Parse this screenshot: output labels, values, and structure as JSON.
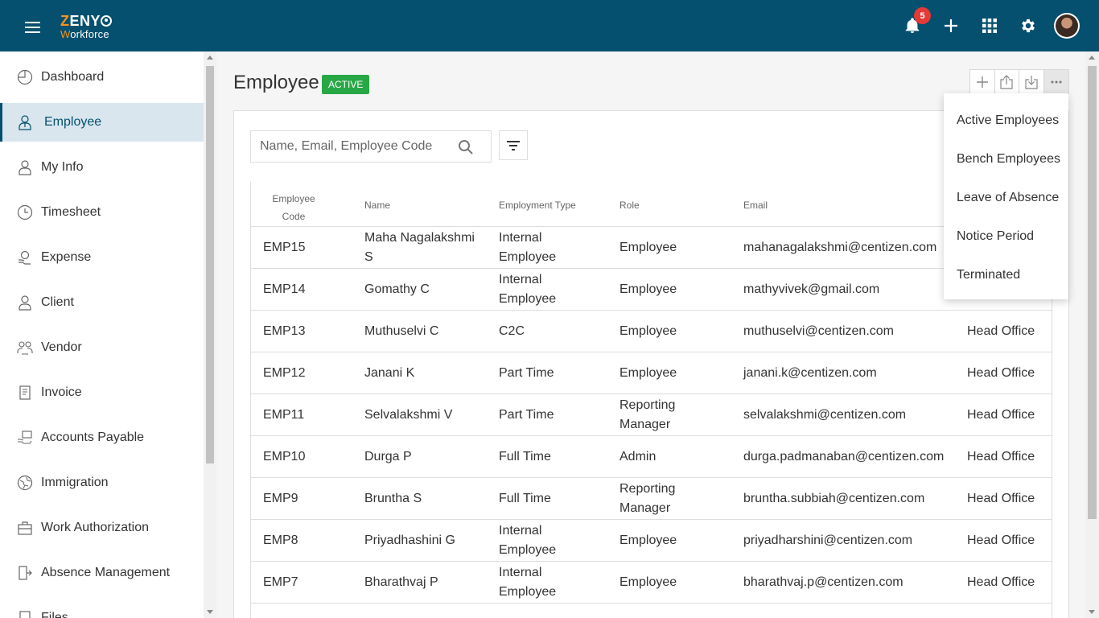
{
  "header": {
    "logo_top": "ZENY",
    "logo_sub": "Workforce",
    "notification_count": "5"
  },
  "sidebar": {
    "items": [
      {
        "label": "Dashboard",
        "icon": "dashboard-icon"
      },
      {
        "label": "Employee",
        "icon": "employee-icon",
        "active": true
      },
      {
        "label": "My Info",
        "icon": "my-info-icon"
      },
      {
        "label": "Timesheet",
        "icon": "timesheet-icon"
      },
      {
        "label": "Expense",
        "icon": "expense-icon"
      },
      {
        "label": "Client",
        "icon": "client-icon"
      },
      {
        "label": "Vendor",
        "icon": "vendor-icon"
      },
      {
        "label": "Invoice",
        "icon": "invoice-icon"
      },
      {
        "label": "Accounts Payable",
        "icon": "accounts-payable-icon"
      },
      {
        "label": "Immigration",
        "icon": "immigration-icon"
      },
      {
        "label": "Work Authorization",
        "icon": "work-authorization-icon"
      },
      {
        "label": "Absence Management",
        "icon": "absence-management-icon"
      },
      {
        "label": "Files",
        "icon": "files-icon"
      }
    ]
  },
  "page": {
    "title": "Employee",
    "status": "ACTIVE"
  },
  "search": {
    "placeholder": "Name, Email, Employee Code"
  },
  "table": {
    "headers": {
      "code_line1": "Employee",
      "code_line2": "Code",
      "name": "Name",
      "employment_type": "Employment Type",
      "role": "Role",
      "email": "Email"
    },
    "rows": [
      {
        "code": "EMP15",
        "name": [
          "Maha Nagalakshmi",
          "S"
        ],
        "type": [
          "Internal",
          "Employee"
        ],
        "role": [
          "Employee"
        ],
        "email": "mahanagalakshmi@centizen.com",
        "office": ""
      },
      {
        "code": "EMP14",
        "name": [
          "Gomathy C"
        ],
        "type": [
          "Internal",
          "Employee"
        ],
        "role": [
          "Employee"
        ],
        "email": "mathyvivek@gmail.com",
        "office": ""
      },
      {
        "code": "EMP13",
        "name": [
          "Muthuselvi C"
        ],
        "type": [
          "C2C"
        ],
        "role": [
          "Employee"
        ],
        "email": "muthuselvi@centizen.com",
        "office": "Head Office"
      },
      {
        "code": "EMP12",
        "name": [
          "Janani K"
        ],
        "type": [
          "Part Time"
        ],
        "role": [
          "Employee"
        ],
        "email": "janani.k@centizen.com",
        "office": "Head Office"
      },
      {
        "code": "EMP11",
        "name": [
          "Selvalakshmi V"
        ],
        "type": [
          "Part Time"
        ],
        "role": [
          "Reporting",
          "Manager"
        ],
        "email": "selvalakshmi@centizen.com",
        "office": "Head Office"
      },
      {
        "code": "EMP10",
        "name": [
          "Durga P"
        ],
        "type": [
          "Full Time"
        ],
        "role": [
          "Admin"
        ],
        "email": "durga.padmanaban@centizen.com",
        "office": "Head Office"
      },
      {
        "code": "EMP9",
        "name": [
          "Bruntha S"
        ],
        "type": [
          "Full Time"
        ],
        "role": [
          "Reporting",
          "Manager"
        ],
        "email": "bruntha.subbiah@centizen.com",
        "office": "Head Office"
      },
      {
        "code": "EMP8",
        "name": [
          "Priyadhashini G"
        ],
        "type": [
          "Internal",
          "Employee"
        ],
        "role": [
          "Employee"
        ],
        "email": "priyadharshini@centizen.com",
        "office": "Head Office"
      },
      {
        "code": "EMP7",
        "name": [
          "Bharathvaj P"
        ],
        "type": [
          "Internal",
          "Employee"
        ],
        "role": [
          "Employee"
        ],
        "email": "bharathvaj.p@centizen.com",
        "office": "Head Office"
      }
    ]
  },
  "dropdown": {
    "items": [
      "Active Employees",
      "Bench Employees",
      "Leave of Absence",
      "Notice Period",
      "Terminated"
    ]
  },
  "colors": {
    "header_bg": "#05506e",
    "accent": "#f7941d",
    "active_badge": "#28a745",
    "notification_badge": "#e53935",
    "active_nav_bg": "#d9e6ee"
  }
}
